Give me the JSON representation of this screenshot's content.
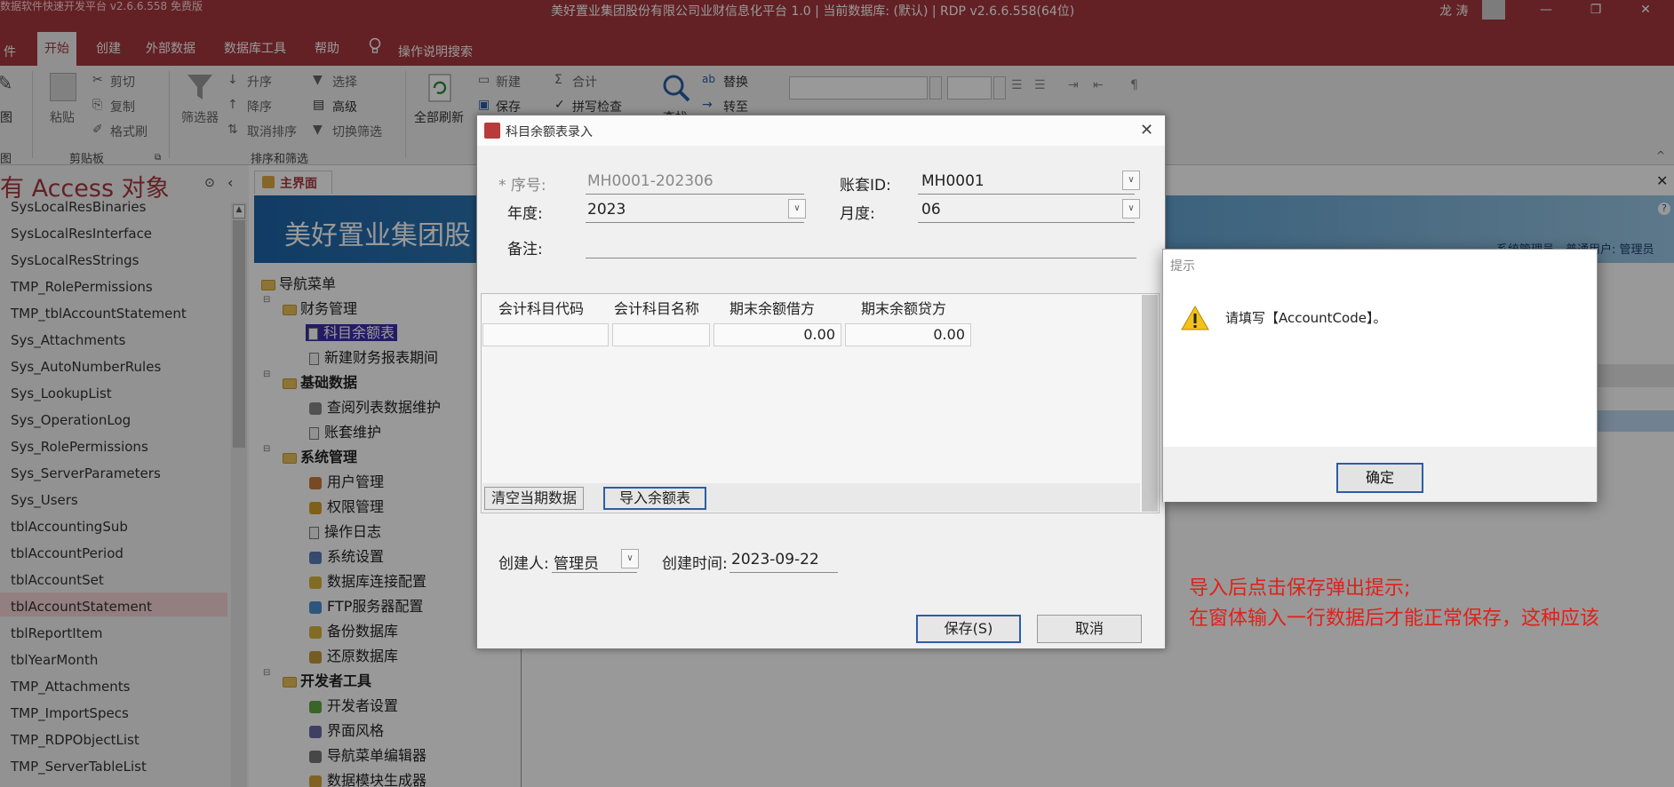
{
  "titlebar": {
    "watermark": "数据软件快速开发平台 v2.6.6.558 免费版",
    "title": "美好置业集团股份有限公司业财信息化平台 1.0 | 当前数据库: (默认) | RDP v2.6.6.558(64位)",
    "user": "龙 涛",
    "minimize": "—",
    "restore": "❐",
    "close": "✕"
  },
  "ribbon": {
    "tabs": [
      {
        "label": "件"
      },
      {
        "label": "开始"
      },
      {
        "label": "创建"
      },
      {
        "label": "外部数据"
      },
      {
        "label": "数据库工具"
      },
      {
        "label": "帮助"
      }
    ],
    "search": "操作说明搜索",
    "view_label": "图",
    "view_group": "图",
    "clipboard": {
      "paste": "粘贴",
      "cut": "剪切",
      "copy": "复制",
      "format_painter": "格式刷",
      "group": "剪贴板"
    },
    "sort_filter": {
      "filter": "筛选器",
      "asc": "升序",
      "desc": "降序",
      "clear_sort": "取消排序",
      "selection": "选择",
      "advanced": "高级",
      "toggle": "切换筛选",
      "group": "排序和筛选"
    },
    "records": {
      "refresh": "全部刷新",
      "new": "新建",
      "save": "保存",
      "totals": "合计",
      "spelling": "拼写检查"
    },
    "find": {
      "find": "查找",
      "replace": "替换",
      "goto": "转至"
    }
  },
  "nav": {
    "header": "有 Access 对象",
    "items": [
      "SysLocalResBinaries",
      "SysLocalResInterface",
      "SysLocalResStrings",
      "TMP_RolePermissions",
      "TMP_tblAccountStatement",
      "Sys_Attachments",
      "Sys_AutoNumberRules",
      "Sys_LookupList",
      "Sys_OperationLog",
      "Sys_RolePermissions",
      "Sys_ServerParameters",
      "Sys_Users",
      "tblAccountingSub",
      "tblAccountPeriod",
      "tblAccountSet",
      "tblAccountStatement",
      "tblReportItem",
      "tblYearMonth",
      "TMP_Attachments",
      "TMP_ImportSpecs",
      "TMP_RDPObjectList",
      "TMP_ServerTableList"
    ]
  },
  "doc": {
    "tab": "主界面",
    "banner": "美好置业集团股",
    "banner_right": "系统管理员，普通用户: 管理员",
    "tree": {
      "root": "导航菜单",
      "finance": "财务管理",
      "subject_balance": "科目余额表",
      "new_period": "新建财务报表期间",
      "basic": "基础数据",
      "list_maint": "查阅列表数据维护",
      "account_set": "账套维护",
      "system": "系统管理",
      "users": "用户管理",
      "perms": "权限管理",
      "oplog": "操作日志",
      "settings": "系统设置",
      "dbconn": "数据库连接配置",
      "ftp": "FTP服务器配置",
      "backup": "备份数据库",
      "restore": "还原数据库",
      "devtools": "开发者工具",
      "devset": "开发者设置",
      "style": "界面风格",
      "nav_editor": "导航菜单编辑器",
      "module_gen": "数据模块生成器"
    }
  },
  "form": {
    "title": "科目余额表录入",
    "seq_label": "* 序号:",
    "seq_value": "MH0001-202306",
    "acct_label": "账套ID:",
    "acct_value": "MH0001",
    "year_label": "年度:",
    "year_value": "2023",
    "month_label": "月度:",
    "month_value": "06",
    "note_label": "备注:",
    "columns": [
      "会计科目代码",
      "会计科目名称",
      "期末余额借方",
      "期末余额贷方"
    ],
    "row": [
      "",
      "",
      "0.00",
      "0.00"
    ],
    "clear_btn": "清空当期数据",
    "import_btn": "导入余额表",
    "creator_label": "创建人:",
    "creator_value": "管理员",
    "created_label": "创建时间:",
    "created_value": "2023-09-22",
    "save_btn": "保存(S)",
    "cancel_btn": "取消"
  },
  "dialog": {
    "title": "提示",
    "message": "请填写【AccountCode】。",
    "ok": "确定"
  },
  "annotation": {
    "line1": "导入后点击保存弹出提示;",
    "line2": "在窗体输入一行数据后才能正常保存，这种应该"
  }
}
